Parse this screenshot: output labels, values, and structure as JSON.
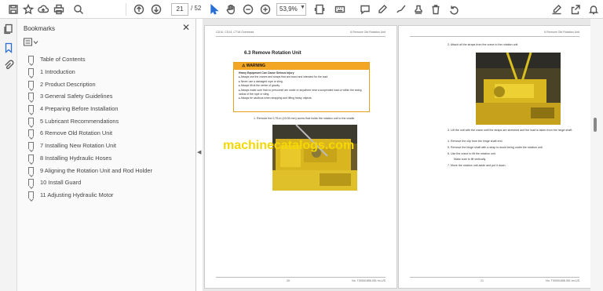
{
  "toolbar": {
    "page_current": "21",
    "page_total": "/ 52",
    "zoom": "53,9%"
  },
  "bookmarks": {
    "title": "Bookmarks",
    "items": [
      {
        "label": "Table of Contents"
      },
      {
        "label": "1 Introduction"
      },
      {
        "label": "2 Product Description"
      },
      {
        "label": "3 General Safety Guidelines"
      },
      {
        "label": "4 Preparing Before Installation"
      },
      {
        "label": "5 Lubricant Recommendations"
      },
      {
        "label": "6 Remove Old Rotation Unit"
      },
      {
        "label": "7 Installing New Rotation Unit"
      },
      {
        "label": "8 Installing Hydraulic Hoses"
      },
      {
        "label": "9 Aligning the Rotation Unit and Rod Holder"
      },
      {
        "label": "10 Install Guard"
      },
      {
        "label": "11 Adjusting Hydraulic Motor"
      }
    ]
  },
  "left_page": {
    "header_left": "CD10, CD14, CT16 Overhead",
    "header_right": "6 Remove Old Rotation Unit",
    "section_title": "6.3  Remove Rotation Unit",
    "warning_label": "WARNING",
    "warning_heading": "Heavy Equipment Can Cause Serious Injury",
    "warning_lines": [
      "Always use the cranes and straps that are intact and intended for the load.",
      "Never use a damaged rope or sling.",
      "Always lift at the center of gravity.",
      "Always make sure that no personnel are under or anywhere near a suspended load or within the swing radius of the rope or sling.",
      "Always be cautious when strapping and lifting heavy objects."
    ],
    "step1": "1.    Remove the 0.75-in (19.05 mm) screw that holds the rotation unit to the cradle.",
    "footer_page": "20",
    "footer_doc": "No. T00001856.051 en-US"
  },
  "right_page": {
    "header_right": "6 Remove Old Rotation Unit",
    "step2": "2.    Attach all the straps from the crane to the rotation unit.",
    "step3": "3.    Lift the unit with the crane until the straps are stretched and the load is taken from the hinge shaft.",
    "step4": "4.    Remove the clip from the hinge shaft end.",
    "step5": "5.    Remove the hinge shaft with a strap to avoid being under the rotation unit.",
    "step6": "6.    Use the crane to lift the rotation unit.",
    "step6b": "Make sure to lift vertically.",
    "step7": "7.    Move the rotation unit aside and put it down.",
    "footer_page": "21",
    "footer_doc": "No. T00001856.051 en-US"
  },
  "watermark": "machinecatalogs.com"
}
